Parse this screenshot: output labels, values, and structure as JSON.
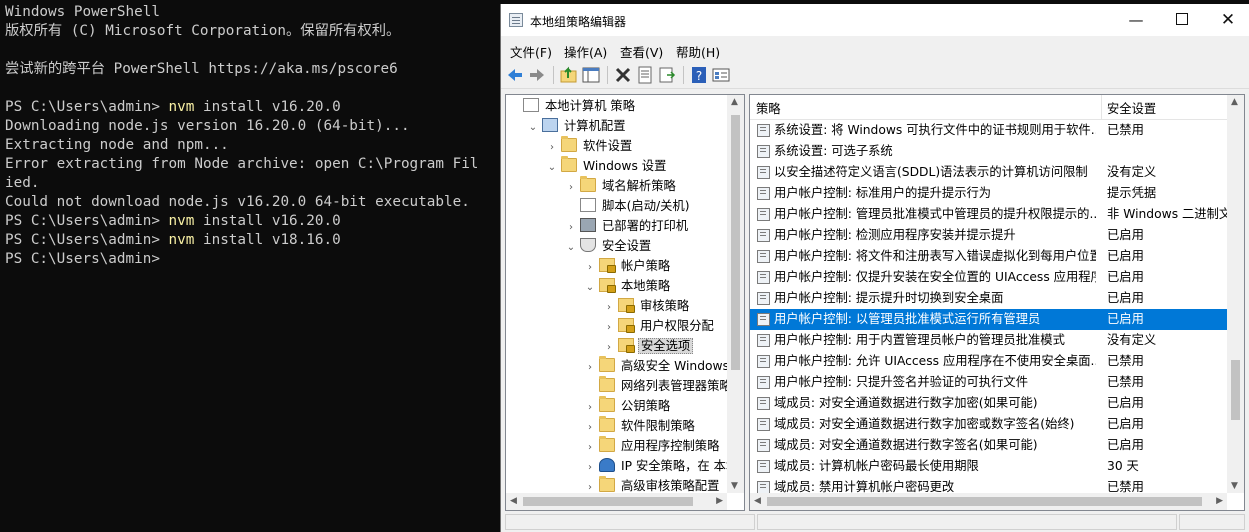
{
  "console": {
    "lines": [
      {
        "prefix": "Windows PowerShell",
        "cmd": "",
        "rest": ""
      },
      {
        "prefix": "版权所有 (C) Microsoft Corporation。保留所有权利。",
        "cmd": "",
        "rest": ""
      },
      {
        "prefix": "",
        "cmd": "",
        "rest": ""
      },
      {
        "prefix": "尝试新的跨平台 PowerShell https://aka.ms/pscore6",
        "cmd": "",
        "rest": ""
      },
      {
        "prefix": "",
        "cmd": "",
        "rest": ""
      },
      {
        "prefix": "PS C:\\Users\\admin> ",
        "cmd": "nvm",
        "rest": " install v16.20.0"
      },
      {
        "prefix": "Downloading node.js version 16.20.0 (64-bit)...",
        "cmd": "",
        "rest": ""
      },
      {
        "prefix": "Extracting node and npm...",
        "cmd": "",
        "rest": ""
      },
      {
        "prefix": "Error extracting from Node archive: open C:\\Program Fil",
        "cmd": "",
        "rest": ""
      },
      {
        "prefix": "ied.",
        "cmd": "",
        "rest": ""
      },
      {
        "prefix": "Could not download node.js v16.20.0 64-bit executable.",
        "cmd": "",
        "rest": ""
      },
      {
        "prefix": "PS C:\\Users\\admin> ",
        "cmd": "nvm",
        "rest": " install v16.20.0"
      },
      {
        "prefix": "PS C:\\Users\\admin> ",
        "cmd": "nvm",
        "rest": " install v18.16.0"
      },
      {
        "prefix": "PS C:\\Users\\admin> ",
        "cmd": "",
        "rest": ""
      }
    ]
  },
  "window": {
    "title": "本地组策略编辑器",
    "min_glyph": "—",
    "close_glyph": "✕"
  },
  "menu": [
    "文件(F)",
    "操作(A)",
    "查看(V)",
    "帮助(H)"
  ],
  "tree": [
    {
      "label": "本地计算机 策略",
      "depth": 0,
      "exp": "",
      "icon": "doc"
    },
    {
      "label": "计算机配置",
      "depth": 1,
      "exp": "⌄",
      "icon": "pc"
    },
    {
      "label": "软件设置",
      "depth": 2,
      "exp": "›",
      "icon": "folder"
    },
    {
      "label": "Windows 设置",
      "depth": 2,
      "exp": "⌄",
      "icon": "folder"
    },
    {
      "label": "域名解析策略",
      "depth": 3,
      "exp": "›",
      "icon": "folder"
    },
    {
      "label": "脚本(启动/关机)",
      "depth": 3,
      "exp": "",
      "icon": "doc"
    },
    {
      "label": "已部署的打印机",
      "depth": 3,
      "exp": "›",
      "icon": "printer"
    },
    {
      "label": "安全设置",
      "depth": 3,
      "exp": "⌄",
      "icon": "shield"
    },
    {
      "label": "帐户策略",
      "depth": 4,
      "exp": "›",
      "icon": "lockfolder"
    },
    {
      "label": "本地策略",
      "depth": 4,
      "exp": "⌄",
      "icon": "lockfolder"
    },
    {
      "label": "审核策略",
      "depth": 5,
      "exp": "›",
      "icon": "lockfolder"
    },
    {
      "label": "用户权限分配",
      "depth": 5,
      "exp": "›",
      "icon": "lockfolder"
    },
    {
      "label": "安全选项",
      "depth": 5,
      "exp": "›",
      "icon": "lockfolder",
      "selected": true
    },
    {
      "label": "高级安全 Windows De",
      "depth": 4,
      "exp": "›",
      "icon": "folder"
    },
    {
      "label": "网络列表管理器策略",
      "depth": 4,
      "exp": "",
      "icon": "folder"
    },
    {
      "label": "公钥策略",
      "depth": 4,
      "exp": "›",
      "icon": "folder"
    },
    {
      "label": "软件限制策略",
      "depth": 4,
      "exp": "›",
      "icon": "folder"
    },
    {
      "label": "应用程序控制策略",
      "depth": 4,
      "exp": "›",
      "icon": "folder"
    },
    {
      "label": "IP 安全策略，在 本地计",
      "depth": 4,
      "exp": "›",
      "icon": "ipsec"
    },
    {
      "label": "高级审核策略配置",
      "depth": 4,
      "exp": "›",
      "icon": "folder"
    }
  ],
  "list": {
    "col_policy": "策略",
    "col_setting": "安全设置",
    "rows": [
      {
        "policy": "系统设置: 将 Windows 可执行文件中的证书规则用于软件...",
        "setting": "已禁用"
      },
      {
        "policy": "系统设置: 可选子系统",
        "setting": ""
      },
      {
        "policy": "以安全描述符定义语言(SDDL)语法表示的计算机访问限制",
        "setting": "没有定义"
      },
      {
        "policy": "用户帐户控制: 标准用户的提升提示行为",
        "setting": "提示凭据"
      },
      {
        "policy": "用户帐户控制: 管理员批准模式中管理员的提升权限提示的...",
        "setting": "非 Windows 二进制文..."
      },
      {
        "policy": "用户帐户控制: 检测应用程序安装并提示提升",
        "setting": "已启用"
      },
      {
        "policy": "用户帐户控制: 将文件和注册表写入错误虚拟化到每用户位置",
        "setting": "已启用"
      },
      {
        "policy": "用户帐户控制: 仅提升安装在安全位置的 UIAccess 应用程序",
        "setting": "已启用"
      },
      {
        "policy": "用户帐户控制: 提示提升时切换到安全桌面",
        "setting": "已启用"
      },
      {
        "policy": "用户帐户控制: 以管理员批准模式运行所有管理员",
        "setting": "已启用",
        "selected": true
      },
      {
        "policy": "用户帐户控制: 用于内置管理员帐户的管理员批准模式",
        "setting": "没有定义"
      },
      {
        "policy": "用户帐户控制: 允许 UIAccess 应用程序在不使用安全桌面...",
        "setting": "已禁用"
      },
      {
        "policy": "用户帐户控制: 只提升签名并验证的可执行文件",
        "setting": "已禁用"
      },
      {
        "policy": "域成员: 对安全通道数据进行数字加密(如果可能)",
        "setting": "已启用"
      },
      {
        "policy": "域成员: 对安全通道数据进行数字加密或数字签名(始终)",
        "setting": "已启用"
      },
      {
        "policy": "域成员: 对安全通道数据进行数字签名(如果可能)",
        "setting": "已启用"
      },
      {
        "policy": "域成员: 计算机帐户密码最长使用期限",
        "setting": "30 天"
      },
      {
        "policy": "域成员: 禁用计算机帐户密码更改",
        "setting": "已禁用"
      }
    ]
  }
}
